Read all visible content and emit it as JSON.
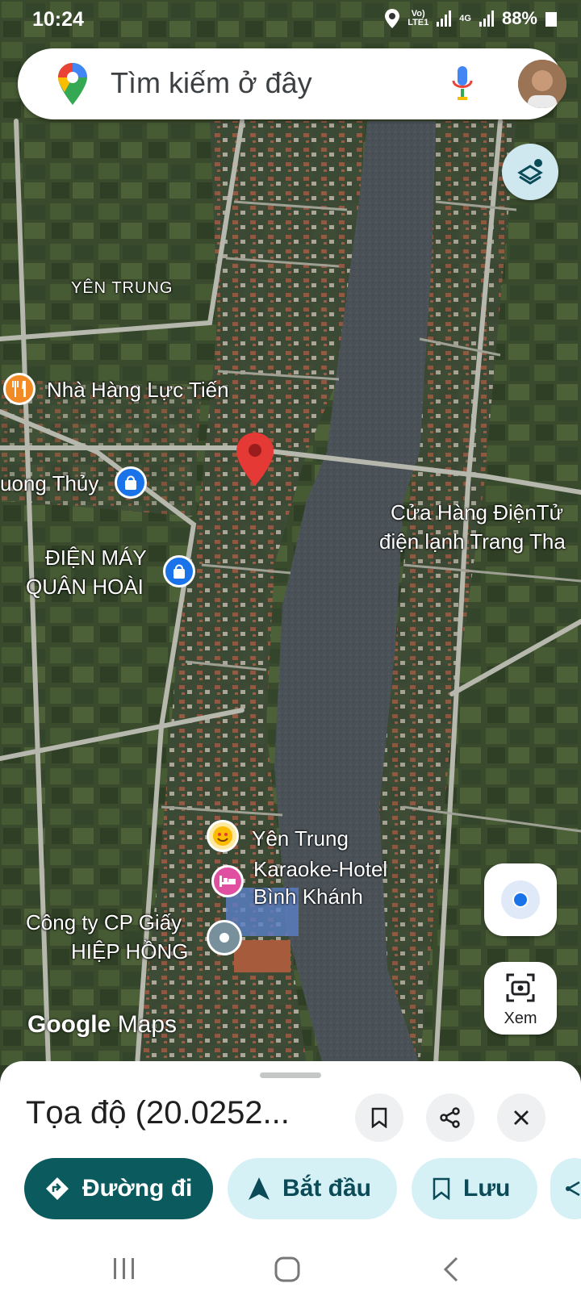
{
  "status_bar": {
    "time": "10:24",
    "net1_top": "Vo)",
    "net1_bottom": "LTE1",
    "net2_top": "4G",
    "battery": "88%"
  },
  "search": {
    "placeholder": "Tìm kiếm ở đây"
  },
  "map_labels": {
    "yen_trung": "YÊN TRUNG",
    "nha_hang": "Nhà Hàng Lực Tiến",
    "uong_thuy": "uong Thủy",
    "dien_may_1": "ĐIỆN MÁY",
    "dien_may_2": "QUÂN HOÀI",
    "cua_hang_1": "Cửa Hàng ĐiệnTử",
    "cua_hang_2": "điện lạnh Trang Tha",
    "yen_trung_poi": "Yên Trung",
    "karaoke_1": "Karaoke-Hotel",
    "karaoke_2": "Bình Khánh",
    "giay_1": "Công ty CP Giấy",
    "giay_2": "HIỆP HỒNG",
    "watermark_google": "Google",
    "watermark_maps": "Maps"
  },
  "controls": {
    "xem_label": "Xem"
  },
  "sheet": {
    "title": "Tọa độ (20.0252...",
    "actions": {
      "directions": "Đường đi",
      "start": "Bắt đầu",
      "save": "Lưu"
    }
  },
  "colors": {
    "primary": "#0b5a5e",
    "tonal": "#d6f1f6",
    "pin": "#e53935",
    "accent_blue": "#1a73e8"
  }
}
